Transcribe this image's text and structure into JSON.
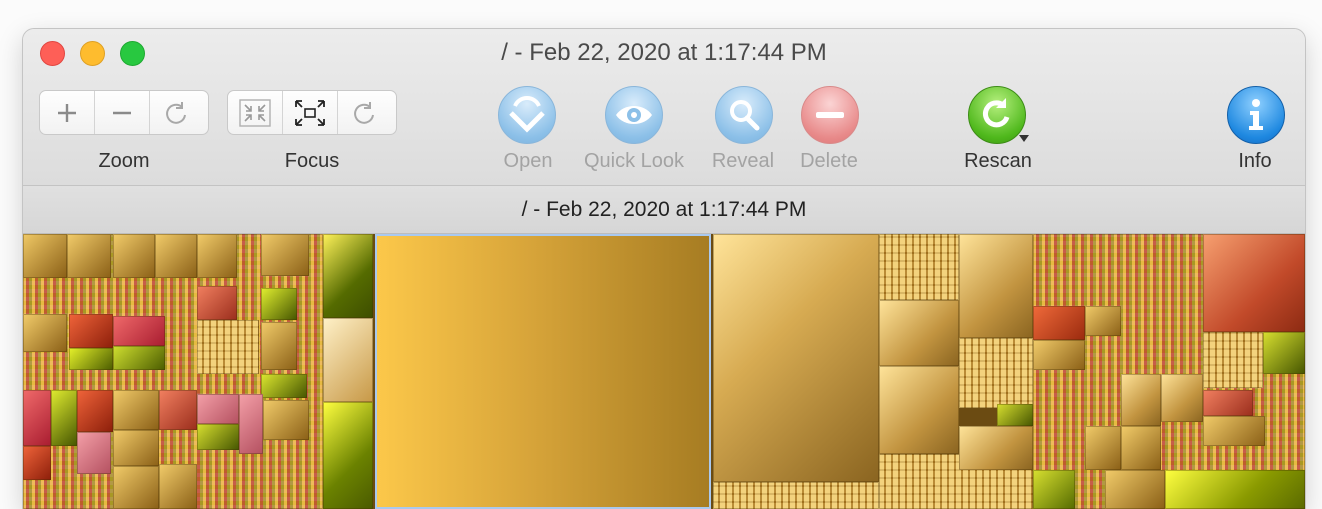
{
  "window": {
    "title": "/ - Feb 22, 2020 at 1:17:44 PM"
  },
  "toolbar": {
    "zoom": {
      "label": "Zoom",
      "buttons": [
        "zoom-in",
        "zoom-out",
        "zoom-reset"
      ]
    },
    "focus": {
      "label": "Focus",
      "buttons": [
        "focus-in",
        "focus-out",
        "focus-reset"
      ]
    },
    "open_label": "Open",
    "quicklook_label": "Quick Look",
    "reveal_label": "Reveal",
    "delete_label": "Delete",
    "rescan_label": "Rescan",
    "info_label": "Info"
  },
  "pathbar": {
    "text": "/ - Feb 22, 2020 at 1:17:44 PM"
  },
  "colors": {
    "close": "#fe5f57",
    "minimize": "#febc2e",
    "maximize": "#28c840",
    "disabled_blue": "#8cc0e8",
    "disabled_red": "#e88a8a",
    "rescan_green": "#4fb81c",
    "info_blue": "#1e88e0",
    "selection": "#a9c9ef"
  },
  "icons": {
    "open": "open-arrow-icon",
    "quicklook": "eye-icon",
    "reveal": "magnifier-icon",
    "delete": "minus-icon",
    "rescan": "refresh-icon",
    "info": "info-icon"
  }
}
